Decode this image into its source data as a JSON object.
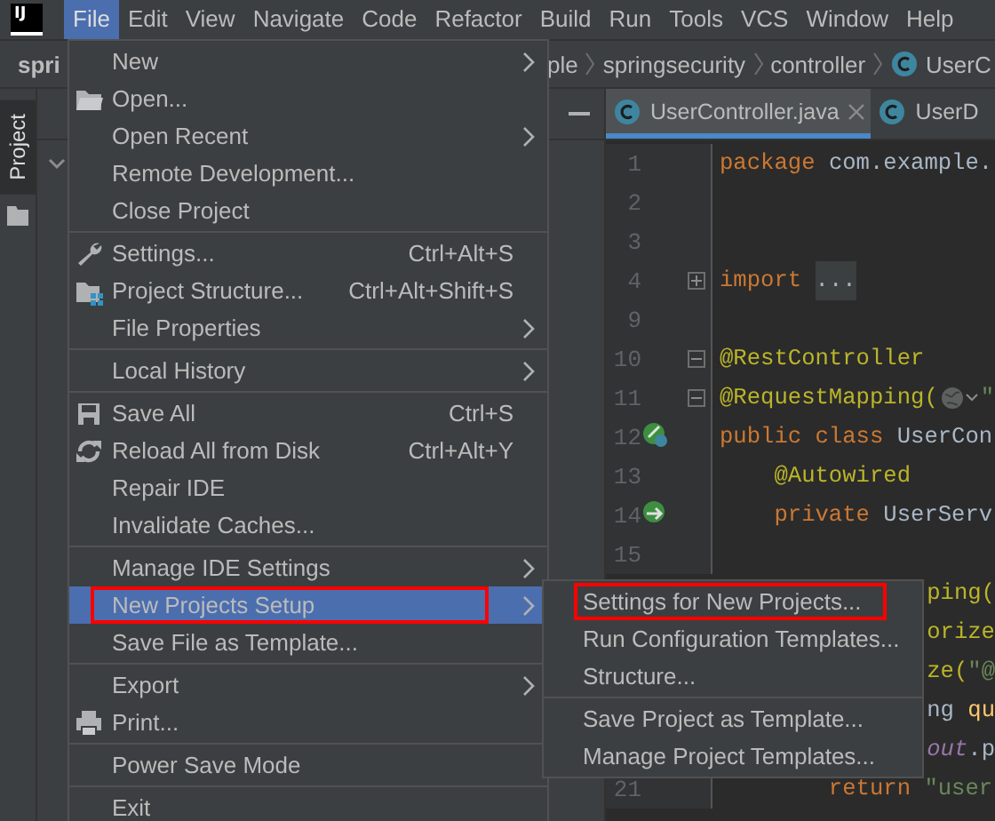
{
  "menubar": {
    "logo": "IJ",
    "menus": [
      {
        "label": "File",
        "selected": true
      },
      {
        "label": "Edit",
        "selected": false
      },
      {
        "label": "View",
        "selected": false
      },
      {
        "label": "Navigate",
        "selected": false
      },
      {
        "label": "Code",
        "selected": false
      },
      {
        "label": "Refactor",
        "selected": false
      },
      {
        "label": "Build",
        "selected": false
      },
      {
        "label": "Run",
        "selected": false
      },
      {
        "label": "Tools",
        "selected": false
      },
      {
        "label": "VCS",
        "selected": false
      },
      {
        "label": "Window",
        "selected": false
      },
      {
        "label": "Help",
        "selected": false
      }
    ]
  },
  "breadcrumb": {
    "project": "spri",
    "items": [
      {
        "label": "ple",
        "kind": "folder"
      },
      {
        "label": "springsecurity",
        "kind": "folder"
      },
      {
        "label": "controller",
        "kind": "folder"
      },
      {
        "label": "UserC",
        "kind": "class"
      }
    ]
  },
  "tool_strip": {
    "label": "Project"
  },
  "editor": {
    "tabs": [
      {
        "label": "UserController.java",
        "selected": true
      },
      {
        "label": "UserD",
        "selected": false
      }
    ],
    "lines": [
      {
        "number": "1",
        "tokens": [
          {
            "text": "package",
            "kind": "keyword"
          },
          {
            "text": " com.example.",
            "kind": "plain"
          }
        ]
      },
      {
        "number": "2"
      },
      {
        "number": "3"
      },
      {
        "number": "4",
        "tokens": [
          {
            "text": "import",
            "kind": "keyword"
          },
          {
            "text": "...",
            "kind": "folded"
          }
        ]
      },
      {
        "number": "9"
      },
      {
        "number": "10",
        "tokens": [
          {
            "text": "@RestController",
            "kind": "annotation"
          }
        ]
      },
      {
        "number": "11",
        "tokens": [
          {
            "text": "@RequestMapping(",
            "kind": "annotation"
          },
          {
            "kind": "inlay"
          },
          {
            "text": "\"",
            "kind": "string"
          }
        ]
      },
      {
        "number": "12",
        "tokens": [
          {
            "text": "public class",
            "kind": "keyword"
          },
          {
            "text": " UserCon",
            "kind": "plain"
          }
        ]
      },
      {
        "number": "13",
        "tokens": [
          {
            "text": "    @Autowired",
            "kind": "annotation"
          }
        ]
      },
      {
        "number": "14",
        "tokens": [
          {
            "text": "    private",
            "kind": "keyword"
          },
          {
            "text": " UserServ",
            "kind": "plain"
          }
        ]
      },
      {
        "number": "15"
      },
      {
        "kind": "partial",
        "tokens": [
          {
            "text": "ping(",
            "kind": "annotation"
          }
        ]
      },
      {
        "kind": "partial",
        "tokens": [
          {
            "text": "orize",
            "kind": "annotation"
          }
        ]
      },
      {
        "kind": "partial",
        "tokens": [
          {
            "text": "ze(",
            "kind": "annotation"
          },
          {
            "text": "\"@",
            "kind": "string"
          }
        ]
      },
      {
        "kind": "partial",
        "tokens": [
          {
            "text": "ng ",
            "kind": "plain"
          },
          {
            "text": "qu",
            "kind": "method"
          }
        ]
      },
      {
        "kind": "partial",
        "tokens": [
          {
            "text": "out",
            "kind": "field"
          },
          {
            "text": ".p",
            "kind": "plain"
          }
        ]
      },
      {
        "number": "21",
        "tokens": [
          {
            "text": "        return",
            "kind": "keyword"
          },
          {
            "text": " \"user",
            "kind": "string"
          }
        ]
      }
    ]
  },
  "file_menu": {
    "items": [
      {
        "kind": "item",
        "label": "New",
        "submenu": true,
        "selected": false
      },
      {
        "kind": "item",
        "label": "Open...",
        "submenu": false,
        "selected": false
      },
      {
        "kind": "item",
        "label": "Open Recent",
        "submenu": true,
        "selected": false
      },
      {
        "kind": "item",
        "label": "Remote Development...",
        "submenu": false,
        "selected": false
      },
      {
        "kind": "item",
        "label": "Close Project",
        "submenu": false,
        "selected": false
      },
      {
        "kind": "separator"
      },
      {
        "kind": "item",
        "label": "Settings...",
        "shortcut": "Ctrl+Alt+S",
        "submenu": false,
        "selected": false
      },
      {
        "kind": "item",
        "label": "Project Structure...",
        "shortcut": "Ctrl+Alt+Shift+S",
        "submenu": false,
        "selected": false
      },
      {
        "kind": "item",
        "label": "File Properties",
        "submenu": true,
        "selected": false
      },
      {
        "kind": "separator"
      },
      {
        "kind": "item",
        "label": "Local History",
        "submenu": true,
        "selected": false
      },
      {
        "kind": "separator"
      },
      {
        "kind": "item",
        "label": "Save All",
        "shortcut": "Ctrl+S",
        "submenu": false,
        "selected": false
      },
      {
        "kind": "item",
        "label": "Reload All from Disk",
        "shortcut": "Ctrl+Alt+Y",
        "submenu": false,
        "selected": false
      },
      {
        "kind": "item",
        "label": "Repair IDE",
        "submenu": false,
        "selected": false
      },
      {
        "kind": "item",
        "label": "Invalidate Caches...",
        "submenu": false,
        "selected": false
      },
      {
        "kind": "separator"
      },
      {
        "kind": "item",
        "label": "Manage IDE Settings",
        "submenu": true,
        "selected": false
      },
      {
        "kind": "item",
        "label": "New Projects Setup",
        "submenu": true,
        "selected": true,
        "outlined": true
      },
      {
        "kind": "item",
        "label": "Save File as Template...",
        "submenu": false,
        "selected": false
      },
      {
        "kind": "separator"
      },
      {
        "kind": "item",
        "label": "Export",
        "submenu": true,
        "selected": false
      },
      {
        "kind": "item",
        "label": "Print...",
        "submenu": false,
        "selected": false
      },
      {
        "kind": "separator"
      },
      {
        "kind": "item",
        "label": "Power Save Mode",
        "submenu": false,
        "selected": false
      },
      {
        "kind": "separator"
      },
      {
        "kind": "item",
        "label": "Exit",
        "submenu": false,
        "selected": false
      }
    ]
  },
  "submenu": {
    "items": [
      {
        "kind": "item",
        "label": "Settings for New Projects...",
        "selected": false,
        "outlined": true
      },
      {
        "kind": "item",
        "label": "Run Configuration Templates...",
        "selected": false
      },
      {
        "kind": "item",
        "label": "Structure...",
        "selected": false
      },
      {
        "kind": "separator"
      },
      {
        "kind": "item",
        "label": "Save Project as Template...",
        "selected": false
      },
      {
        "kind": "item",
        "label": "Manage Project Templates...",
        "selected": false
      }
    ]
  }
}
